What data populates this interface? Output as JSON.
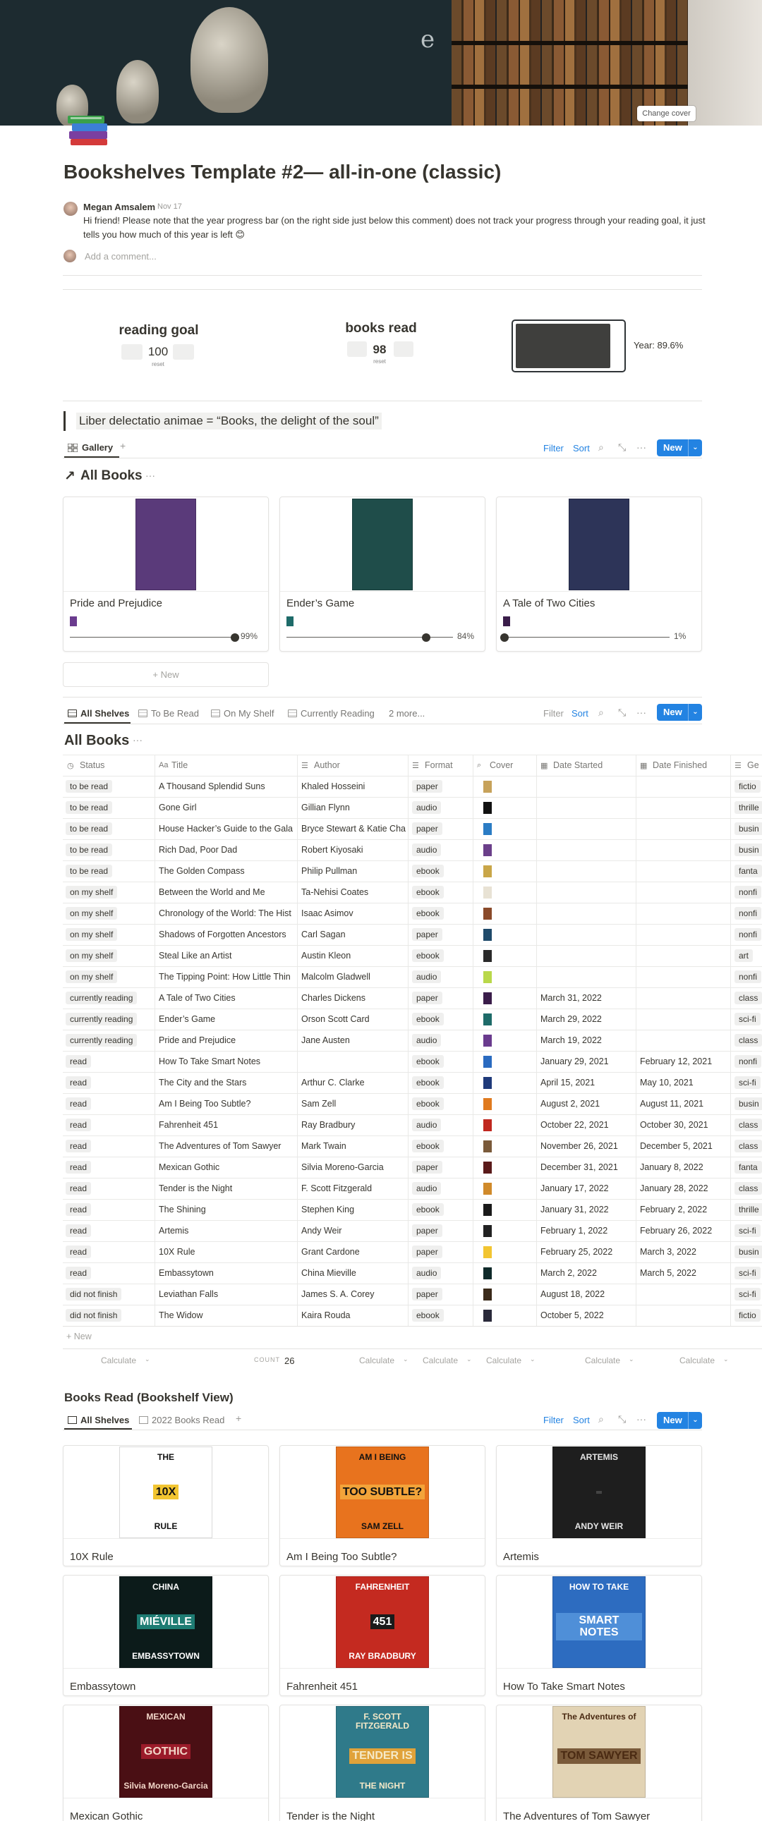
{
  "cover": {
    "change_cover": "Change cover",
    "letter": "e"
  },
  "page": {
    "title": "Bookshelves Template #2— all-in-one (classic)"
  },
  "comment": {
    "author": "Megan Amsalem",
    "date": "Nov 17",
    "text": "Hi friend! Please note that the year progress bar (on the right side just below this comment) does not track your progress through your reading goal, it just tells you how much of this year is left 😊",
    "add_placeholder": "Add a comment..."
  },
  "stats": {
    "goal_label": "reading goal",
    "goal_value": "100",
    "goal_sub": "reset",
    "read_label": "books read",
    "read_value": "98",
    "read_sub": "reset",
    "year_text": "Year: 89.6%",
    "year_progress": 0.896
  },
  "quote": "Liber delectatio animae = “Books, the delight of the soul”",
  "gallery": {
    "tab": "Gallery",
    "add": "+",
    "filter": "Filter",
    "sort": "Sort",
    "new": "New",
    "new_chev": "⌄",
    "title": "All Books",
    "title_arrow": "↗",
    "more": "···",
    "cards": [
      {
        "title": "Pride and Prejudice",
        "pct_label": "99%",
        "progress": 0.99,
        "color": "#5a3a7a",
        "mini": "#6a3b8e"
      },
      {
        "title": "Ender’s Game",
        "pct_label": "84%",
        "progress": 0.84,
        "color": "#1f4d4a",
        "mini": "#1e6b69"
      },
      {
        "title": "A Tale of Two Cities",
        "pct_label": "1%",
        "progress": 0.01,
        "color": "#2d3458",
        "mini": "#3a1d4a"
      }
    ],
    "new_card": "+ New"
  },
  "table": {
    "tabs": [
      "All Shelves",
      "To Be Read",
      "On My Shelf",
      "Currently Reading",
      "2 more..."
    ],
    "filter": "Filter",
    "sort": "Sort",
    "new": "New",
    "new_chev": "⌄",
    "title": "All Books",
    "more": "···",
    "headers": [
      "Status",
      "Title",
      "Author",
      "Format",
      "Cover",
      "Date Started",
      "Date Finished",
      "Ge"
    ],
    "rows": [
      {
        "status": "to be read",
        "title": "A Thousand Splendid Suns",
        "author": "Khaled Hosseini",
        "format": "paper",
        "cover": "#c7a25a",
        "start": "",
        "finish": "",
        "genre": "fictio"
      },
      {
        "status": "to be read",
        "title": "Gone Girl",
        "author": "Gillian Flynn",
        "format": "audio",
        "cover": "#111111",
        "start": "",
        "finish": "",
        "genre": "thrille"
      },
      {
        "status": "to be read",
        "title": "House Hacker’s Guide to the Gala",
        "author": "Bryce Stewart & Katie Cha",
        "format": "paper",
        "cover": "#2b7cc4",
        "start": "",
        "finish": "",
        "genre": "busin"
      },
      {
        "status": "to be read",
        "title": "Rich Dad, Poor Dad",
        "author": "Robert Kiyosaki",
        "format": "audio",
        "cover": "#6b3f8a",
        "start": "",
        "finish": "",
        "genre": "busin"
      },
      {
        "status": "to be read",
        "title": "The Golden Compass",
        "author": "Philip Pullman",
        "format": "ebook",
        "cover": "#c9a648",
        "start": "",
        "finish": "",
        "genre": "fanta"
      },
      {
        "status": "on my shelf",
        "title": "Between the World and Me",
        "author": "Ta-Nehisi Coates",
        "format": "ebook",
        "cover": "#e8e2d4",
        "start": "",
        "finish": "",
        "genre": "nonfi"
      },
      {
        "status": "on my shelf",
        "title": "Chronology of the World: The Hist",
        "author": "Isaac Asimov",
        "format": "ebook",
        "cover": "#8a4a2a",
        "start": "",
        "finish": "",
        "genre": "nonfi"
      },
      {
        "status": "on my shelf",
        "title": "Shadows of Forgotten Ancestors",
        "author": "Carl Sagan",
        "format": "paper",
        "cover": "#1f4a6a",
        "start": "",
        "finish": "",
        "genre": "nonfi"
      },
      {
        "status": "on my shelf",
        "title": "Steal Like an Artist",
        "author": "Austin Kleon",
        "format": "ebook",
        "cover": "#2a2a2a",
        "start": "",
        "finish": "",
        "genre": "art"
      },
      {
        "status": "on my shelf",
        "title": "The Tipping Point: How Little Thin",
        "author": "Malcolm Gladwell",
        "format": "audio",
        "cover": "#b9d84a",
        "start": "",
        "finish": "",
        "genre": "nonfi"
      },
      {
        "status": "currently reading",
        "title": "A Tale of Two Cities",
        "author": "Charles Dickens",
        "format": "paper",
        "cover": "#3a1d4a",
        "start": "March 31, 2022",
        "finish": "",
        "genre": "class"
      },
      {
        "status": "currently reading",
        "title": "Ender’s Game",
        "author": "Orson Scott Card",
        "format": "ebook",
        "cover": "#1e6b69",
        "start": "March 29, 2022",
        "finish": "",
        "genre": "sci-fi"
      },
      {
        "status": "currently reading",
        "title": "Pride and Prejudice",
        "author": "Jane Austen",
        "format": "audio",
        "cover": "#6a3b8e",
        "start": "March 19, 2022",
        "finish": "",
        "genre": "class"
      },
      {
        "status": "read",
        "title": "How To Take Smart Notes",
        "author": "",
        "format": "ebook",
        "cover": "#2a6bc0",
        "start": "January 29, 2021",
        "finish": "February 12, 2021",
        "genre": "nonfi"
      },
      {
        "status": "read",
        "title": "The City and the Stars",
        "author": "Arthur C. Clarke",
        "format": "ebook",
        "cover": "#1f3a7a",
        "start": "April 15, 2021",
        "finish": "May 10, 2021",
        "genre": "sci-fi"
      },
      {
        "status": "read",
        "title": "Am I Being Too Subtle?",
        "author": "Sam Zell",
        "format": "ebook",
        "cover": "#e07a1f",
        "start": "August 2, 2021",
        "finish": "August 11, 2021",
        "genre": "busin"
      },
      {
        "status": "read",
        "title": "Fahrenheit 451",
        "author": "Ray Bradbury",
        "format": "audio",
        "cover": "#c0281f",
        "start": "October 22, 2021",
        "finish": "October 30, 2021",
        "genre": "class"
      },
      {
        "status": "read",
        "title": "The Adventures of Tom Sawyer",
        "author": "Mark Twain",
        "format": "ebook",
        "cover": "#7a5a3a",
        "start": "November 26, 2021",
        "finish": "December 5, 2021",
        "genre": "class"
      },
      {
        "status": "read",
        "title": "Mexican Gothic",
        "author": "Silvia Moreno-Garcia",
        "format": "paper",
        "cover": "#5a1a1a",
        "start": "December 31, 2021",
        "finish": "January 8, 2022",
        "genre": "fanta"
      },
      {
        "status": "read",
        "title": "Tender is the Night",
        "author": "F. Scott Fitzgerald",
        "format": "audio",
        "cover": "#d08a2a",
        "start": "January 17, 2022",
        "finish": "January 28, 2022",
        "genre": "class"
      },
      {
        "status": "read",
        "title": "The Shining",
        "author": "Stephen King",
        "format": "ebook",
        "cover": "#1a1a1a",
        "start": "January 31, 2022",
        "finish": "February 2, 2022",
        "genre": "thrille"
      },
      {
        "status": "read",
        "title": "Artemis",
        "author": "Andy Weir",
        "format": "paper",
        "cover": "#222222",
        "start": "February 1, 2022",
        "finish": "February 26, 2022",
        "genre": "sci-fi"
      },
      {
        "status": "read",
        "title": "10X Rule",
        "author": "Grant Cardone",
        "format": "paper",
        "cover": "#f2c531",
        "start": "February 25, 2022",
        "finish": "March 3, 2022",
        "genre": "busin"
      },
      {
        "status": "read",
        "title": "Embassytown",
        "author": "China Mieville",
        "format": "audio",
        "cover": "#0f2a2a",
        "start": "March 2, 2022",
        "finish": "March 5, 2022",
        "genre": "sci-fi"
      },
      {
        "status": "did not finish",
        "title": "Leviathan Falls",
        "author": "James S. A. Corey",
        "format": "paper",
        "cover": "#3a2a1a",
        "start": "August 18, 2022",
        "finish": "",
        "genre": "sci-fi"
      },
      {
        "status": "did not finish",
        "title": "The Widow",
        "author": "Kaira Rouda",
        "format": "ebook",
        "cover": "#2a2a3a",
        "start": "October 5, 2022",
        "finish": "",
        "genre": "fictio"
      }
    ],
    "new_row": "+ New",
    "calc": "Calculate",
    "count_label": "COUNT",
    "count_value": "26"
  },
  "bookshelf": {
    "title": "Books Read (Bookshelf View)",
    "tabs": [
      "All Shelves",
      "2022 Books Read"
    ],
    "add": "+",
    "filter": "Filter",
    "sort": "Sort",
    "new": "New",
    "new_chev": "⌄",
    "cards": [
      {
        "title": "10X Rule",
        "bg": "#ffffff",
        "lines": [
          "THE",
          "10X",
          "RULE"
        ],
        "fg": "#111111",
        "accent": "#f2c531"
      },
      {
        "title": "Am I Being Too Subtle?",
        "bg": "#e8731e",
        "lines": [
          "AM I BEING",
          "TOO SUBTLE?",
          "SAM ZELL"
        ],
        "fg": "#111111",
        "accent": "#f3a43a"
      },
      {
        "title": "Artemis",
        "bg": "#1e1e1e",
        "lines": [
          "ARTEMIS",
          "",
          "ANDY WEIR"
        ],
        "fg": "#e6e6e6",
        "accent": "#444444"
      },
      {
        "title": "Embassytown",
        "bg": "#0c1b1a",
        "lines": [
          "CHINA",
          "MIÉVILLE",
          "EMBASSYTOWN"
        ],
        "fg": "#ffffff",
        "accent": "#1e7c73"
      },
      {
        "title": "Fahrenheit 451",
        "bg": "#c42a20",
        "lines": [
          "FAHRENHEIT",
          "451",
          "RAY BRADBURY"
        ],
        "fg": "#ffffff",
        "accent": "#1a1a1a"
      },
      {
        "title": "How To Take Smart Notes",
        "bg": "#2d6cc0",
        "lines": [
          "HOW TO TAKE",
          "SMART NOTES",
          ""
        ],
        "fg": "#ffffff",
        "accent": "#4f8fd8"
      },
      {
        "title": "Mexican Gothic",
        "bg": "#4a0f14",
        "lines": [
          "MEXICAN",
          "GOTHIC",
          "Silvia Moreno-Garcia"
        ],
        "fg": "#f2d6c8",
        "accent": "#9b1b2a"
      },
      {
        "title": "Tender is the Night",
        "bg": "#2f7a8a",
        "lines": [
          "F. SCOTT FITZGERALD",
          "TENDER IS",
          "THE NIGHT"
        ],
        "fg": "#f5e9c8",
        "accent": "#e0a23a"
      },
      {
        "title": "The Adventures of Tom Sawyer",
        "bg": "#e2d3b4",
        "lines": [
          "The Adventures of",
          "TOM SAWYER",
          ""
        ],
        "fg": "#4a2a12",
        "accent": "#7a5a3a"
      }
    ]
  }
}
